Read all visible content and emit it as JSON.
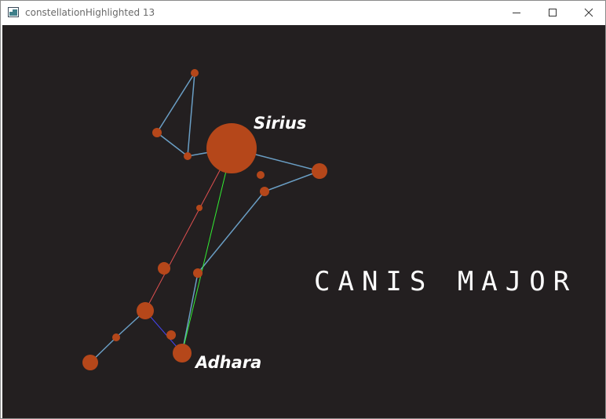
{
  "window": {
    "title": "constellationHighlighted 13",
    "buttons": {
      "minimize_icon": "minimize-icon",
      "maximize_icon": "maximize-icon",
      "close_icon": "close-icon"
    }
  },
  "scene": {
    "background": "#231f20",
    "star_color": "#b5471a",
    "line_color": "#6a9ec4",
    "highlight_colors": {
      "red": "#e05050",
      "green": "#33ee33",
      "blue": "#4444ee"
    },
    "constellation_name": "CANIS MAJOR",
    "star_labels": {
      "sirius": "Sirius",
      "adhara": "Adhara"
    }
  }
}
